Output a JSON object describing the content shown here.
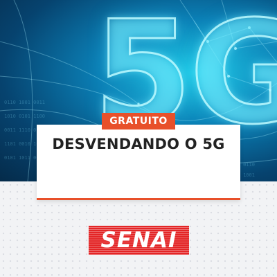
{
  "hero": {
    "headline": "5G"
  },
  "card": {
    "badge": "GRATUITO",
    "title": "DESVENDANDO O 5G"
  },
  "logo": {
    "text": "SENAI"
  },
  "colors": {
    "accent": "#e8502a",
    "logo_red": "#e32526",
    "hero_cyan": "#1ec9e6",
    "hero_navy": "#052b4a"
  }
}
